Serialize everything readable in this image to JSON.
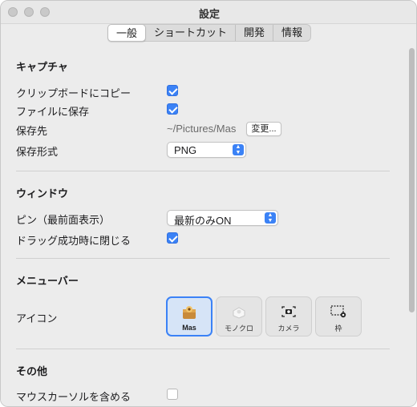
{
  "window": {
    "title": "設定"
  },
  "tabs": [
    "一般",
    "ショートカット",
    "開発",
    "情報"
  ],
  "capture": {
    "title": "キャプチャ",
    "copy_label": "クリップボードにコピー",
    "file_label": "ファイルに保存",
    "dest_label": "保存先",
    "dest_path": "~/Pictures/Mas",
    "change_button": "変更...",
    "format_label": "保存形式",
    "format_value": "PNG"
  },
  "window_section": {
    "title": "ウィンドウ",
    "pin_label": "ピン（最前面表示）",
    "pin_value": "最新のみON",
    "drag_label": "ドラッグ成功時に閉じる"
  },
  "menubar": {
    "title": "メニューバー",
    "icon_label": "アイコン",
    "icons": [
      "Mas",
      "モノクロ",
      "カメラ",
      "枠"
    ]
  },
  "other": {
    "title": "その他",
    "cursor_label": "マウスカーソルを含める"
  },
  "checkbox_states": {
    "copy": true,
    "file": true,
    "drag": true,
    "cursor": false
  },
  "colors": {
    "accent": "#3b82f6"
  }
}
